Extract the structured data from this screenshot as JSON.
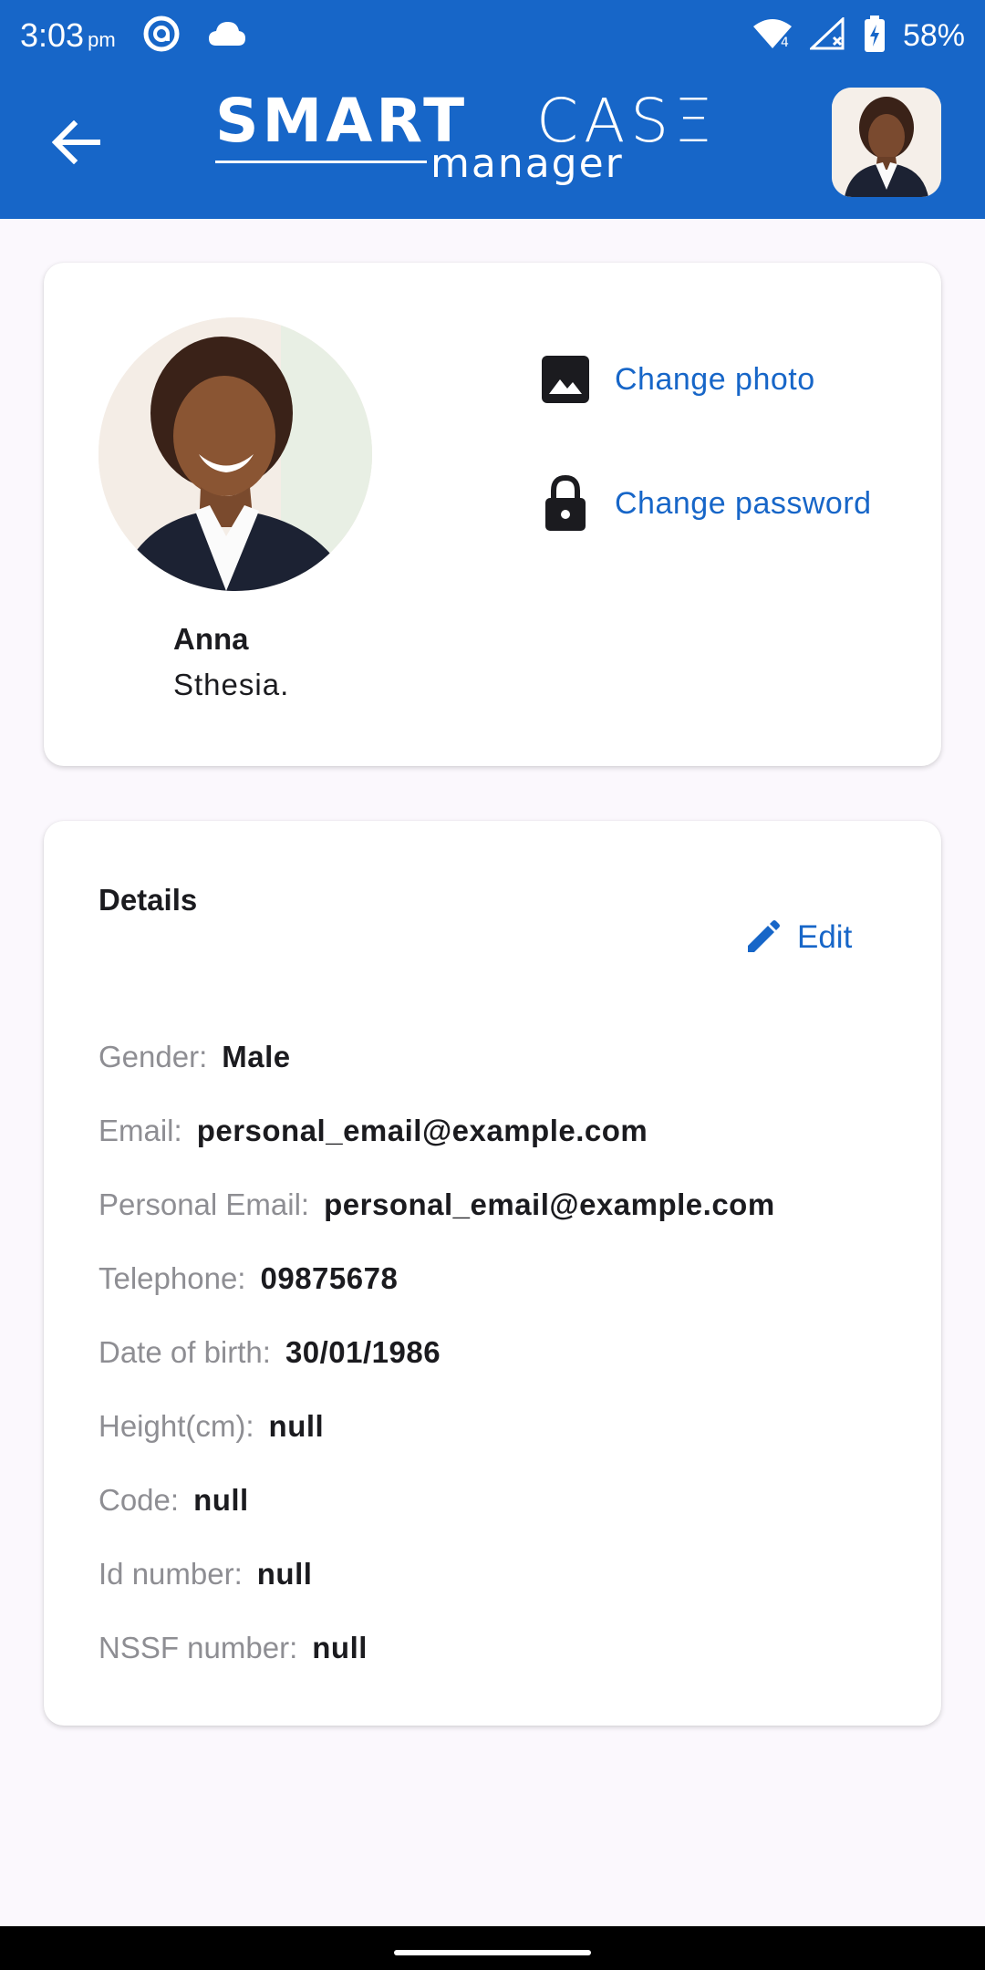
{
  "status_bar": {
    "time": "3:03",
    "ampm": "pm",
    "battery": "58%",
    "icons": [
      "at-sign-icon",
      "cloud-icon",
      "wifi-icon",
      "signal-off-icon",
      "battery-charging-icon"
    ]
  },
  "app_bar": {
    "logo_primary": "SMART",
    "logo_secondary": "CASΞ",
    "logo_sub": "manager",
    "back_icon": "arrow-left-icon"
  },
  "profile": {
    "first_name": "Anna",
    "last_name": "Sthesia.",
    "change_photo_label": "Change photo",
    "change_password_label": "Change password"
  },
  "details": {
    "title": "Details",
    "edit_label": "Edit",
    "rows": [
      {
        "label": "Gender:",
        "value": "Male"
      },
      {
        "label": "Email:",
        "value": "personal_email@example.com"
      },
      {
        "label": "Personal Email:",
        "value": "personal_email@example.com"
      },
      {
        "label": "Telephone:",
        "value": "09875678"
      },
      {
        "label": "Date of birth:",
        "value": "30/01/1986"
      },
      {
        "label": "Height(cm):",
        "value": "null"
      },
      {
        "label": "Code:",
        "value": "null"
      },
      {
        "label": "Id number:",
        "value": "null"
      },
      {
        "label": "NSSF number:",
        "value": "null"
      }
    ]
  },
  "colors": {
    "primary": "#1766c8",
    "background": "#fbf8fd",
    "label_gray": "#8e8e93",
    "text_dark": "#1b1b1f"
  }
}
